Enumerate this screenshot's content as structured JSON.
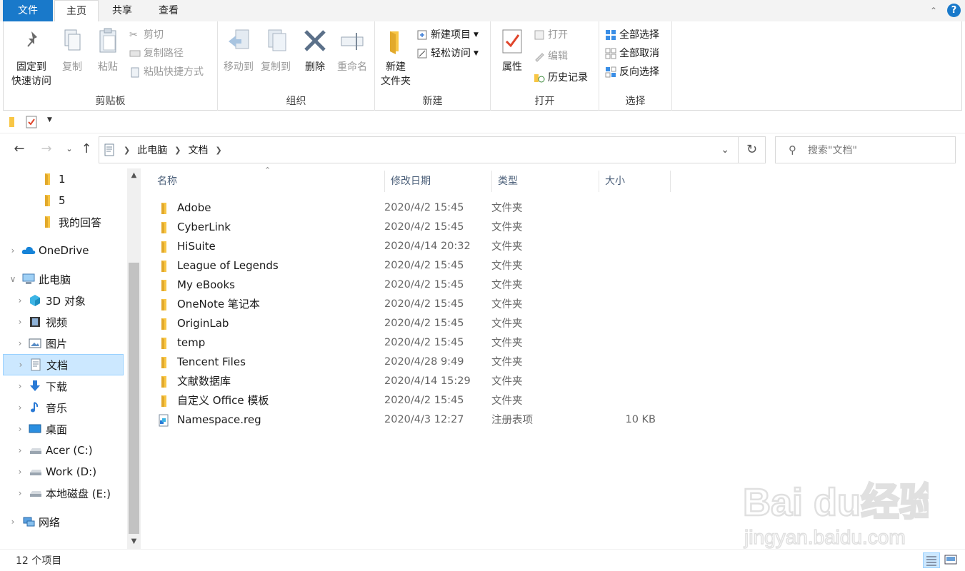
{
  "tabs": {
    "file": "文件",
    "home": "主页",
    "share": "共享",
    "view": "查看"
  },
  "ribbon": {
    "clipboard": {
      "label": "剪贴板",
      "pin": "固定到\n快速访问",
      "pin_l1": "固定到",
      "pin_l2": "快速访问",
      "copy": "复制",
      "paste": "粘贴",
      "cut": "剪切",
      "copy_path": "复制路径",
      "paste_shortcut": "粘贴快捷方式"
    },
    "organize": {
      "label": "组织",
      "move_to": "移动到",
      "copy_to": "复制到",
      "delete": "删除",
      "rename": "重命名"
    },
    "new": {
      "label": "新建",
      "new_folder_l1": "新建",
      "new_folder_l2": "文件夹",
      "new_item": "新建项目",
      "easy_access": "轻松访问"
    },
    "open": {
      "label": "打开",
      "properties": "属性",
      "open": "打开",
      "edit": "编辑",
      "history": "历史记录"
    },
    "select": {
      "label": "选择",
      "select_all": "全部选择",
      "select_none": "全部取消",
      "invert": "反向选择"
    }
  },
  "address": {
    "crumbs": [
      "此电脑",
      "文档"
    ],
    "search_placeholder": "搜索\"文档\""
  },
  "nav": {
    "items": [
      {
        "label": "1",
        "icon": "folder-icon",
        "expandable": false
      },
      {
        "label": "5",
        "icon": "folder-icon",
        "expandable": false
      },
      {
        "label": "我的回答",
        "icon": "folder-icon",
        "expandable": false
      },
      {
        "label": "OneDrive",
        "icon": "cloud-icon",
        "expandable": true
      },
      {
        "label": "此电脑",
        "icon": "computer-icon",
        "expandable": true,
        "expanded": true
      },
      {
        "label": "3D 对象",
        "icon": "cube-icon",
        "expandable": true
      },
      {
        "label": "视频",
        "icon": "video-icon",
        "expandable": true
      },
      {
        "label": "图片",
        "icon": "picture-icon",
        "expandable": true
      },
      {
        "label": "文档",
        "icon": "document-icon",
        "expandable": true,
        "selected": true
      },
      {
        "label": "下载",
        "icon": "download-icon",
        "expandable": true
      },
      {
        "label": "音乐",
        "icon": "music-icon",
        "expandable": true
      },
      {
        "label": "桌面",
        "icon": "desktop-icon",
        "expandable": true
      },
      {
        "label": "Acer (C:)",
        "icon": "drive-icon",
        "expandable": true
      },
      {
        "label": "Work (D:)",
        "icon": "drive-icon",
        "expandable": true
      },
      {
        "label": "本地磁盘 (E:)",
        "icon": "drive-icon",
        "expandable": true
      },
      {
        "label": "网络",
        "icon": "network-icon",
        "expandable": true
      }
    ]
  },
  "columns": {
    "name": "名称",
    "modified": "修改日期",
    "type": "类型",
    "size": "大小"
  },
  "files": [
    {
      "name": "Adobe",
      "date": "2020/4/2 15:45",
      "type": "文件夹",
      "size": "",
      "icon": "folder-icon"
    },
    {
      "name": "CyberLink",
      "date": "2020/4/2 15:45",
      "type": "文件夹",
      "size": "",
      "icon": "folder-icon"
    },
    {
      "name": "HiSuite",
      "date": "2020/4/14 20:32",
      "type": "文件夹",
      "size": "",
      "icon": "folder-icon"
    },
    {
      "name": "League of Legends",
      "date": "2020/4/2 15:45",
      "type": "文件夹",
      "size": "",
      "icon": "folder-icon"
    },
    {
      "name": "My eBooks",
      "date": "2020/4/2 15:45",
      "type": "文件夹",
      "size": "",
      "icon": "folder-icon"
    },
    {
      "name": "OneNote 笔记本",
      "date": "2020/4/2 15:45",
      "type": "文件夹",
      "size": "",
      "icon": "folder-icon"
    },
    {
      "name": "OriginLab",
      "date": "2020/4/2 15:45",
      "type": "文件夹",
      "size": "",
      "icon": "folder-icon"
    },
    {
      "name": "temp",
      "date": "2020/4/2 15:45",
      "type": "文件夹",
      "size": "",
      "icon": "folder-icon"
    },
    {
      "name": "Tencent Files",
      "date": "2020/4/28 9:49",
      "type": "文件夹",
      "size": "",
      "icon": "folder-icon"
    },
    {
      "name": "文献数据库",
      "date": "2020/4/14 15:29",
      "type": "文件夹",
      "size": "",
      "icon": "folder-icon"
    },
    {
      "name": "自定义 Office 模板",
      "date": "2020/4/2 15:45",
      "type": "文件夹",
      "size": "",
      "icon": "folder-icon"
    },
    {
      "name": "Namespace.reg",
      "date": "2020/4/3 12:27",
      "type": "注册表项",
      "size": "10 KB",
      "icon": "registry-file-icon"
    }
  ],
  "status": {
    "count": "12 个项目"
  },
  "watermark": {
    "text": "Baidu经验",
    "url": "jingyan.baidu.com"
  },
  "colors": {
    "accent": "#1979ca",
    "folder": "#f8c645",
    "selection": "#cce8ff"
  }
}
